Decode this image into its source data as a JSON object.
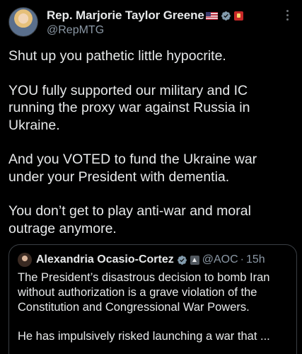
{
  "post": {
    "author_name": "Rep. Marjorie Taylor Greene",
    "handle": "@RepMTG",
    "paragraphs": [
      "Shut up you pathetic little hypocrite.",
      "YOU fully supported our military and IC running the proxy war against Russia in Ukraine.",
      "And you VOTED to fund the Ukraine war under your President with dementia.",
      "You don’t get to play anti-war and moral outrage anymore."
    ]
  },
  "quoted_post": {
    "author_name": "Alexandria Ocasio-Cortez",
    "handle": "@AOC",
    "separator": "·",
    "timestamp": "15h",
    "paragraphs": [
      "The President’s disastrous decision to bomb Iran without authorization is a grave violation of the Constitution and Congressional War Powers.",
      "He has impulsively risked launching a war that ..."
    ]
  },
  "colors": {
    "background": "#000000",
    "text": "#e7e9ea",
    "secondary_text": "#8b98a5",
    "verified_badge": "#829aab",
    "border": "#3a3f44"
  },
  "icons": {
    "flag": "us-flag-icon",
    "verified": "verified-badge-icon",
    "government": "government-badge-icon",
    "more": "more-options-icon"
  }
}
